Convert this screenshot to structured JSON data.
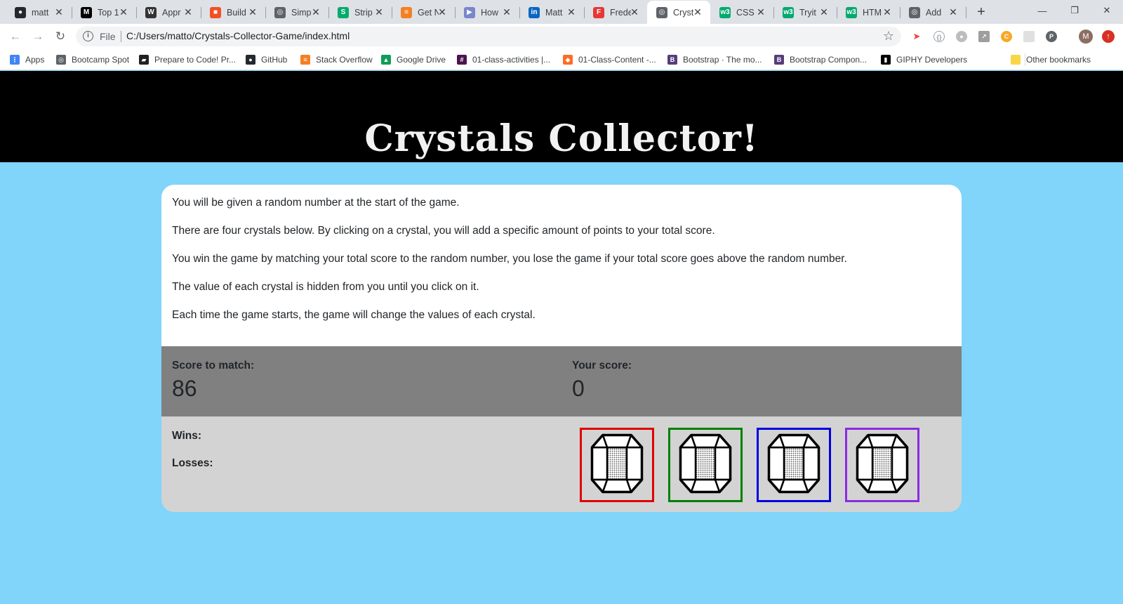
{
  "tabs": [
    {
      "title": "matt",
      "icon_name": "github-icon",
      "icon_color": "#24292e",
      "glyph": "●"
    },
    {
      "title": "Top 1",
      "icon_name": "medium-icon",
      "icon_color": "#000000",
      "glyph": "M"
    },
    {
      "title": "Appr",
      "icon_name": "w-icon",
      "icon_color": "#333333",
      "glyph": "W"
    },
    {
      "title": "Build",
      "icon_name": "microsoft-icon",
      "icon_color": "#f25022",
      "glyph": "■"
    },
    {
      "title": "Simp",
      "icon_name": "globe-icon",
      "icon_color": "#5f6368",
      "glyph": "◎"
    },
    {
      "title": "Strip",
      "icon_name": "w3-icon",
      "icon_color": "#04aa6d",
      "glyph": "S"
    },
    {
      "title": "Get N",
      "icon_name": "stackoverflow-icon",
      "icon_color": "#f48024",
      "glyph": "≡"
    },
    {
      "title": "How",
      "icon_name": "bookmark-icon",
      "icon_color": "#7986cb",
      "glyph": "▶"
    },
    {
      "title": "Matt",
      "icon_name": "linkedin-icon",
      "icon_color": "#0a66c2",
      "glyph": "in"
    },
    {
      "title": "Frede",
      "icon_name": "f-icon",
      "icon_color": "#e53935",
      "glyph": "F"
    },
    {
      "title": "Cryst",
      "icon_name": "globe-icon",
      "icon_color": "#5f6368",
      "glyph": "◎"
    },
    {
      "title": "CSS B",
      "icon_name": "w3schools-icon",
      "icon_color": "#04aa6d",
      "glyph": "w3"
    },
    {
      "title": "Tryit",
      "icon_name": "w3schools-icon",
      "icon_color": "#04aa6d",
      "glyph": "w3"
    },
    {
      "title": "HTM",
      "icon_name": "w3schools-icon",
      "icon_color": "#04aa6d",
      "glyph": "w3"
    },
    {
      "title": "Add",
      "icon_name": "globe-icon",
      "icon_color": "#5f6368",
      "glyph": "◎"
    }
  ],
  "omnibox": {
    "scheme": "File",
    "url": "C:/Users/matto/Crystals-Collector-Game/index.html"
  },
  "bookmarks": [
    {
      "label": "Apps",
      "icon_name": "apps-grid-icon",
      "icon_color": "#4285f4",
      "glyph": "⋮"
    },
    {
      "label": "Bootcamp Spot",
      "icon_name": "globe-icon",
      "icon_color": "#5f6368",
      "glyph": "◎"
    },
    {
      "label": "Prepare to Code! Pr...",
      "icon_name": "book-icon",
      "icon_color": "#202124",
      "glyph": "▰"
    },
    {
      "label": "GitHub",
      "icon_name": "github-icon",
      "icon_color": "#24292e",
      "glyph": "●"
    },
    {
      "label": "Stack Overflow",
      "icon_name": "stackoverflow-icon",
      "icon_color": "#f48024",
      "glyph": "≡"
    },
    {
      "label": "Google Drive",
      "icon_name": "google-drive-icon",
      "icon_color": "#0f9d58",
      "glyph": "▲"
    },
    {
      "label": "01-class-activities |...",
      "icon_name": "slack-icon",
      "icon_color": "#4a154b",
      "glyph": "#"
    },
    {
      "label": "01-Class-Content -...",
      "icon_name": "gitlab-icon",
      "icon_color": "#fc6d26",
      "glyph": "◆"
    },
    {
      "label": "Bootstrap · The mo...",
      "icon_name": "bootstrap-icon",
      "icon_color": "#563d7c",
      "glyph": "B"
    },
    {
      "label": "Bootstrap Compon...",
      "icon_name": "bootstrap-icon",
      "icon_color": "#563d7c",
      "glyph": "B"
    },
    {
      "label": "GIPHY Developers",
      "icon_name": "giphy-icon",
      "icon_color": "#000000",
      "glyph": "▮"
    },
    {
      "label": "Other bookmarks",
      "icon_name": "folder-icon",
      "icon_color": "#f9d648",
      "glyph": ""
    }
  ],
  "profile_initial": "M",
  "page": {
    "title": "Crystals Collector!",
    "instructions": [
      "You will be given a random number at the start of the game.",
      "There are four crystals below. By clicking on a crystal, you will add a specific amount of points to your total score.",
      "You win the game by matching your total score to the random number, you lose the game if your total score goes above the random number.",
      "The value of each crystal is hidden from you until you click on it.",
      "Each time the game starts, the game will change the values of each crystal."
    ],
    "score_to_match_label": "Score to match:",
    "score_to_match": "86",
    "your_score_label": "Your score:",
    "your_score": "0",
    "wins_label": "Wins:",
    "wins": "",
    "losses_label": "Losses:",
    "losses": "",
    "crystals": [
      {
        "icon_name": "crystal-icon",
        "border_color": "#e00000"
      },
      {
        "icon_name": "crystal-icon",
        "border_color": "#008000"
      },
      {
        "icon_name": "crystal-icon",
        "border_color": "#0000e0"
      },
      {
        "icon_name": "crystal-icon",
        "border_color": "#8a2be2"
      }
    ]
  },
  "colors": {
    "page_background": "#81d4fa",
    "banner": "#000000",
    "score_panel": "#808080",
    "stats_panel": "#d3d3d3"
  }
}
